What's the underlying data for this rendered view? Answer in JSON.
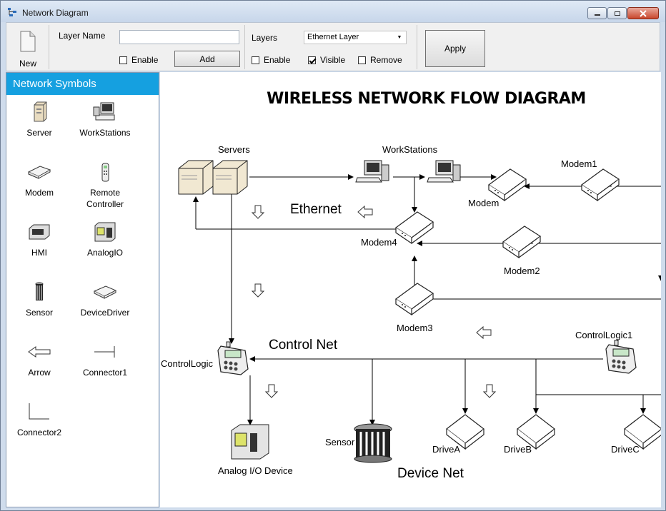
{
  "window": {
    "title": "Network Diagram"
  },
  "toolbar": {
    "new_label": "New",
    "layer_name_label": "Layer Name",
    "layer_name_value": "",
    "enable_label": "Enable",
    "enable_checked": false,
    "add_label": "Add",
    "layers_label": "Layers",
    "layers_selected": "Ethernet Layer",
    "layers_enable_label": "Enable",
    "layers_enable_checked": false,
    "visible_label": "Visible",
    "visible_checked": true,
    "remove_label": "Remove",
    "remove_checked": false,
    "apply_label": "Apply"
  },
  "sidebar": {
    "title": "Network Symbols",
    "symbols": [
      {
        "label": "Server",
        "icon": "server-icon"
      },
      {
        "label": "WorkStations",
        "icon": "workstation-icon"
      },
      {
        "label": "Modem",
        "icon": "modem-icon"
      },
      {
        "label": "Remote Controller",
        "icon": "remote-controller-icon"
      },
      {
        "label": "HMI",
        "icon": "hmi-icon"
      },
      {
        "label": "AnalogIO",
        "icon": "analog-io-icon"
      },
      {
        "label": "Sensor",
        "icon": "sensor-icon"
      },
      {
        "label": "DeviceDriver",
        "icon": "device-driver-icon"
      },
      {
        "label": "Arrow",
        "icon": "arrow-icon"
      },
      {
        "label": "Connector1",
        "icon": "connector1-icon"
      },
      {
        "label": "Connector2",
        "icon": "connector2-icon"
      }
    ]
  },
  "diagram": {
    "title": "WIRELESS NETWORK FLOW DIAGRAM",
    "nets": {
      "ethernet": "Ethernet",
      "control": "Control Net",
      "device": "Device Net"
    },
    "nodes": {
      "servers": "Servers",
      "workstations": "WorkStations",
      "modem1": "Modem1",
      "modem": "Modem",
      "modem4": "Modem4",
      "modem2": "Modem2",
      "modem3": "Modem3",
      "controllogic": "ControlLogic",
      "controllogic1": "ControlLogic1",
      "analog": "Analog I/O Device",
      "sensor": "Sensor",
      "driveA": "DriveA",
      "driveB": "DriveB",
      "driveC": "DriveC"
    }
  }
}
